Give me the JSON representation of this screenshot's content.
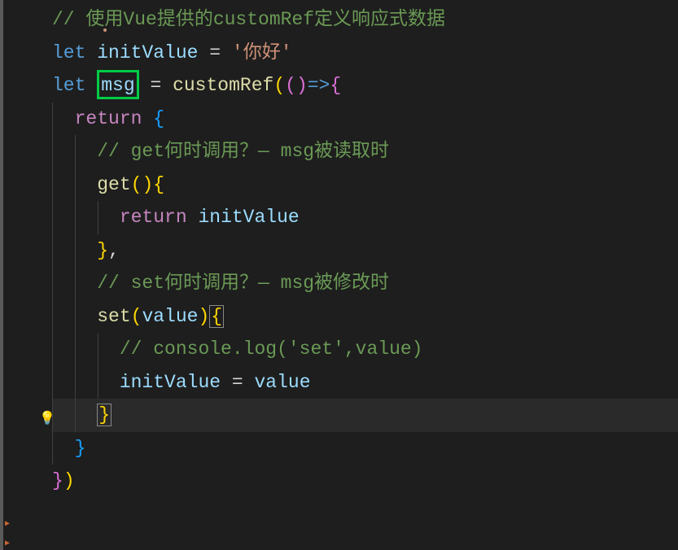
{
  "code": {
    "line1_comment": "// 使用Vue提供的customRef定义响应式数据",
    "line2_let": "let",
    "line2_var": "initValue",
    "line2_eq": " = ",
    "line2_str": "'你好'",
    "line3_let": "let",
    "line3_var": "msg",
    "line3_eq": " = ",
    "line3_fn": "customRef",
    "line3_paren1": "(",
    "line3_paren2": "(",
    "line3_paren3": ")",
    "line3_arrow": "=>",
    "line3_brace": "{",
    "line4_return": "return",
    "line4_brace": " {",
    "line5_comment": "// get何时调用？— msg被读取时",
    "line6_get": "get",
    "line6_parens": "()",
    "line6_brace": "{",
    "line7_return": "return",
    "line7_var": " initValue",
    "line8_brace": "}",
    "line8_comma": ",",
    "line9_comment": "// set何时调用？— msg被修改时",
    "line10_set": "set",
    "line10_paren1": "(",
    "line10_param": "value",
    "line10_paren2": ")",
    "line10_brace": "{",
    "line11_comment": "// console.log('set',value)",
    "line12_var1": "initValue",
    "line12_eq": " = ",
    "line12_var2": "value",
    "line13_brace": "}",
    "line14_brace": "}",
    "line15_brace": "}",
    "line15_paren": ")"
  },
  "icons": {
    "lightbulb": "💡"
  }
}
